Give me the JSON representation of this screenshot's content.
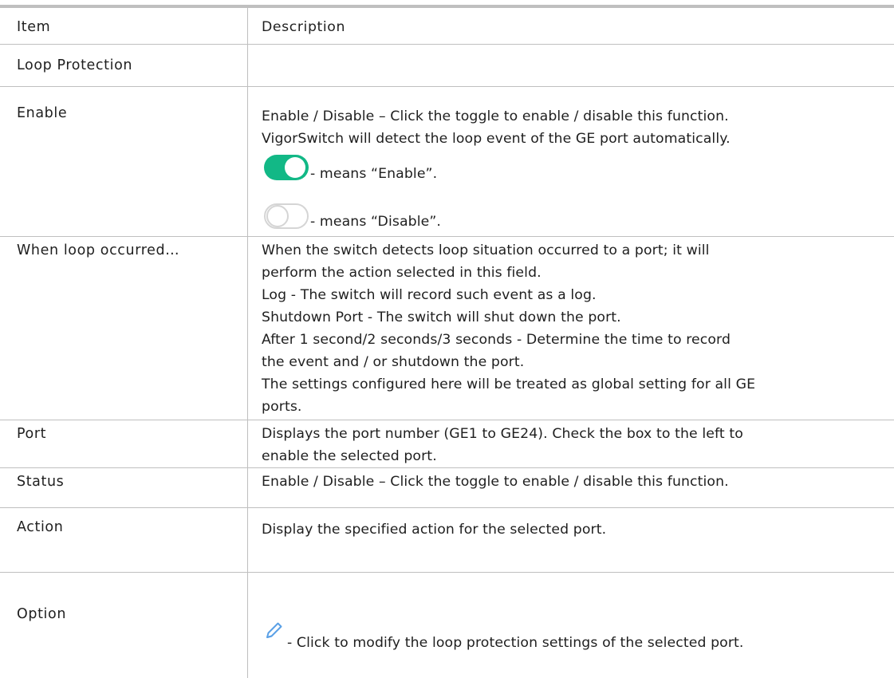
{
  "header": {
    "item": "Item",
    "description": "Description"
  },
  "section": {
    "title": "Loop Protection"
  },
  "rows": {
    "enable": {
      "item": "Enable",
      "desc": [
        "Enable / Disable – Click the toggle to enable / disable this function.",
        "VigorSwitch will detect the loop event of the GE port automatically."
      ],
      "toggle_on_label": "- means “Enable”.",
      "toggle_off_label": "- means “Disable”."
    },
    "when_loop": {
      "item": "When loop occurred…",
      "desc": [
        "When the switch detects loop situation occurred to a port; it will",
        "perform the action selected in this field.",
        "Log - The switch will record such event as a log.",
        "Shutdown Port - The switch will shut down the port.",
        "After 1 second/2 seconds/3 seconds - Determine the time to record",
        "the event and / or shutdown the port.",
        "The settings configured here will be treated as global setting for all GE",
        "ports."
      ]
    },
    "port": {
      "item": "Port",
      "desc": [
        "Displays the port number (GE1 to GE24). Check the box to the left to",
        "enable the selected port."
      ]
    },
    "status": {
      "item": "Status",
      "desc": [
        "Enable / Disable – Click the toggle to enable / disable this function."
      ]
    },
    "action": {
      "item": "Action",
      "desc": [
        "Display the specified action for the selected port."
      ]
    },
    "option": {
      "item": "Option",
      "desc": [
        "- Click to modify the loop protection settings of the selected port."
      ]
    }
  },
  "icons": {
    "toggle_on": "toggle-on-icon",
    "toggle_off": "toggle-off-icon",
    "edit": "pencil-icon"
  },
  "colors": {
    "toggle_on": "#12b886",
    "toggle_off_border": "#d5d5d5",
    "pencil": "#5aa0e6",
    "rule": "#bfbfbf"
  }
}
